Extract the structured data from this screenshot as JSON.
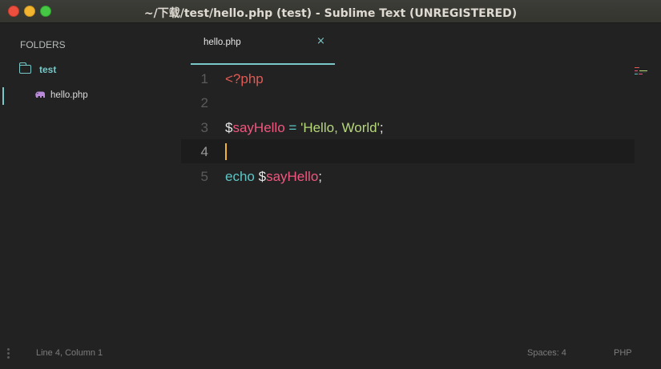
{
  "window": {
    "title": "~/下载/test/hello.php (test) - Sublime Text (UNREGISTERED)"
  },
  "sidebar": {
    "header": "FOLDERS",
    "folder": {
      "label": "test",
      "icon": "folder-icon"
    },
    "files": [
      {
        "label": "hello.php",
        "icon": "php-elephant-icon",
        "active": true
      }
    ]
  },
  "tabs": [
    {
      "label": "hello.php",
      "close_glyph": "×",
      "active": true
    }
  ],
  "editor": {
    "current_line": 4,
    "lines": [
      {
        "number": "1",
        "text": "<?php"
      },
      {
        "number": "2",
        "text": ""
      },
      {
        "number": "3",
        "text": "$sayHello = 'Hello, World';"
      },
      {
        "number": "4",
        "text": ""
      },
      {
        "number": "5",
        "text": "echo $sayHello;"
      }
    ],
    "tokens": {
      "l1_open_tag": "<?php",
      "l3_dollar": "$",
      "l3_var": "sayHello",
      "l3_space1": " ",
      "l3_op": "=",
      "l3_space2": " ",
      "l3_str": "'Hello, World'",
      "l3_semi": ";",
      "l5_kw": "echo",
      "l5_space": " ",
      "l5_dollar": "$",
      "l5_var": "sayHello",
      "l5_semi": ";"
    }
  },
  "statusbar": {
    "position": "Line 4, Column 1",
    "indentation": "Spaces: 4",
    "syntax": "PHP"
  },
  "colors": {
    "accent": "#7ac7c7",
    "caret": "#f2b530",
    "background": "#222222",
    "php_tag": "#e05a55",
    "variable": "#f0577e",
    "string": "#b6d77a",
    "keyword": "#5fc6c6"
  }
}
